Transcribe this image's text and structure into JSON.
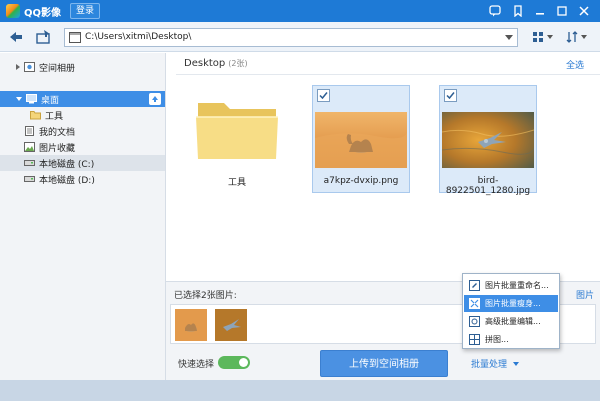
{
  "app": {
    "title": "QQ影像",
    "login_label": "登录"
  },
  "toolbar": {
    "path": "C:\\Users\\xitmi\\Desktop\\"
  },
  "sidebar": {
    "items": [
      {
        "label": "空间相册",
        "icon": "cloud-album-icon"
      },
      {
        "label": "桌面",
        "icon": "desktop-icon"
      },
      {
        "label": "工具",
        "icon": "folder-icon"
      },
      {
        "label": "我的文档",
        "icon": "document-icon"
      },
      {
        "label": "图片收藏",
        "icon": "picture-icon"
      },
      {
        "label": "本地磁盘 (C:)",
        "icon": "disk-icon"
      },
      {
        "label": "本地磁盘 (D:)",
        "icon": "disk-icon"
      }
    ]
  },
  "main": {
    "folder": "Desktop",
    "count": "(2张)",
    "select_all": "全选",
    "tiles": [
      {
        "label": "工具",
        "type": "folder",
        "selected": false
      },
      {
        "label": "a7kpz-dvxip.png",
        "type": "image",
        "selected": true
      },
      {
        "label": "bird-8922501_1280.jpg",
        "type": "image",
        "selected": true
      }
    ]
  },
  "selection": {
    "label": "已选择2张图片:",
    "right_link": "图片"
  },
  "bottom": {
    "quick_select_label": "快速选择",
    "upload_label": "上传到空间相册",
    "batch_label": "批量处理"
  },
  "batch_menu": {
    "items": [
      {
        "label": "图片批量重命名...",
        "icon": "rename-icon"
      },
      {
        "label": "图片批量瘦身...",
        "icon": "compress-icon"
      },
      {
        "label": "高级批量编辑...",
        "icon": "batch-edit-icon"
      },
      {
        "label": "拼图...",
        "icon": "collage-icon"
      }
    ]
  },
  "colors": {
    "accent": "#1e7ad6",
    "selection": "#3e8ee6",
    "toggle_on": "#5cb85c"
  }
}
